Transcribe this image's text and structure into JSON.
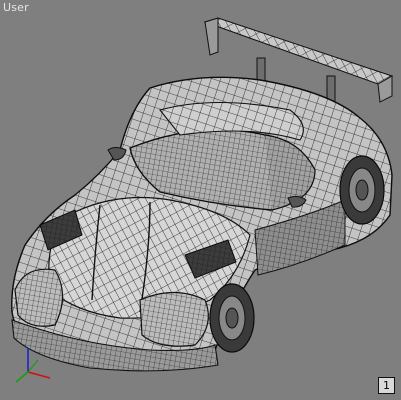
{
  "viewport": {
    "label": "User",
    "background_color": "#7f7f7f",
    "wire_color": "#111111",
    "shade_light": "#d2d2d2",
    "shade_mid": "#b4b4b4",
    "shade_dark": "#5a5a5a"
  },
  "model": {
    "icon": "race-car-wireframe-mesh"
  },
  "gizmo": {
    "icon": "axis-tripod-icon",
    "x_color": "#d01010",
    "y_color": "#10a010",
    "z_color": "#1020d0"
  },
  "badge": {
    "text": "1"
  }
}
